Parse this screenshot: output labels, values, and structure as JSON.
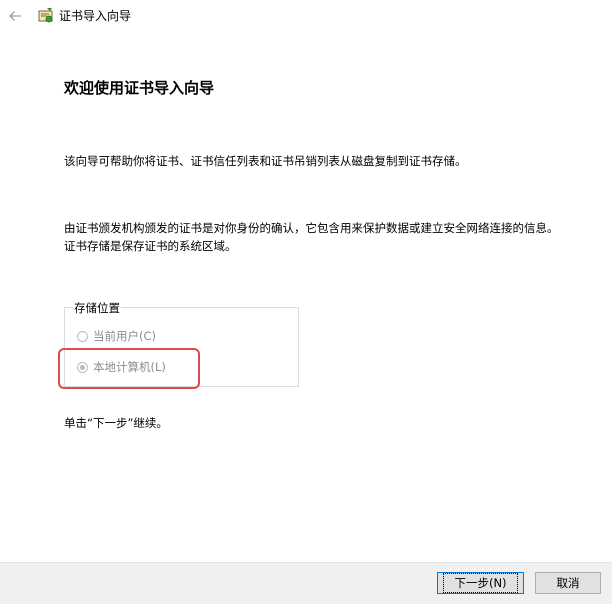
{
  "window": {
    "title": "证书导入向导"
  },
  "icons": {
    "back": "back-arrow-icon",
    "app": "certificate-icon"
  },
  "wizard": {
    "heading": "欢迎使用证书导入向导",
    "intro": "该向导可帮助你将证书、证书信任列表和证书吊销列表从磁盘复制到证书存储。",
    "description": "由证书颁发机构颁发的证书是对你身份的确认，它包含用来保护数据或建立安全网络连接的信息。证书存储是保存证书的系统区域。",
    "storage": {
      "legend": "存储位置",
      "options": [
        {
          "label": "当前用户(C)",
          "selected": false,
          "enabled": false
        },
        {
          "label": "本地计算机(L)",
          "selected": true,
          "enabled": false
        }
      ]
    },
    "continue_text": "单击“下一步”继续。"
  },
  "buttons": {
    "next": "下一步(N)",
    "cancel": "取消"
  },
  "colors": {
    "highlight": "#e04a4a",
    "accent": "#0078d7"
  }
}
